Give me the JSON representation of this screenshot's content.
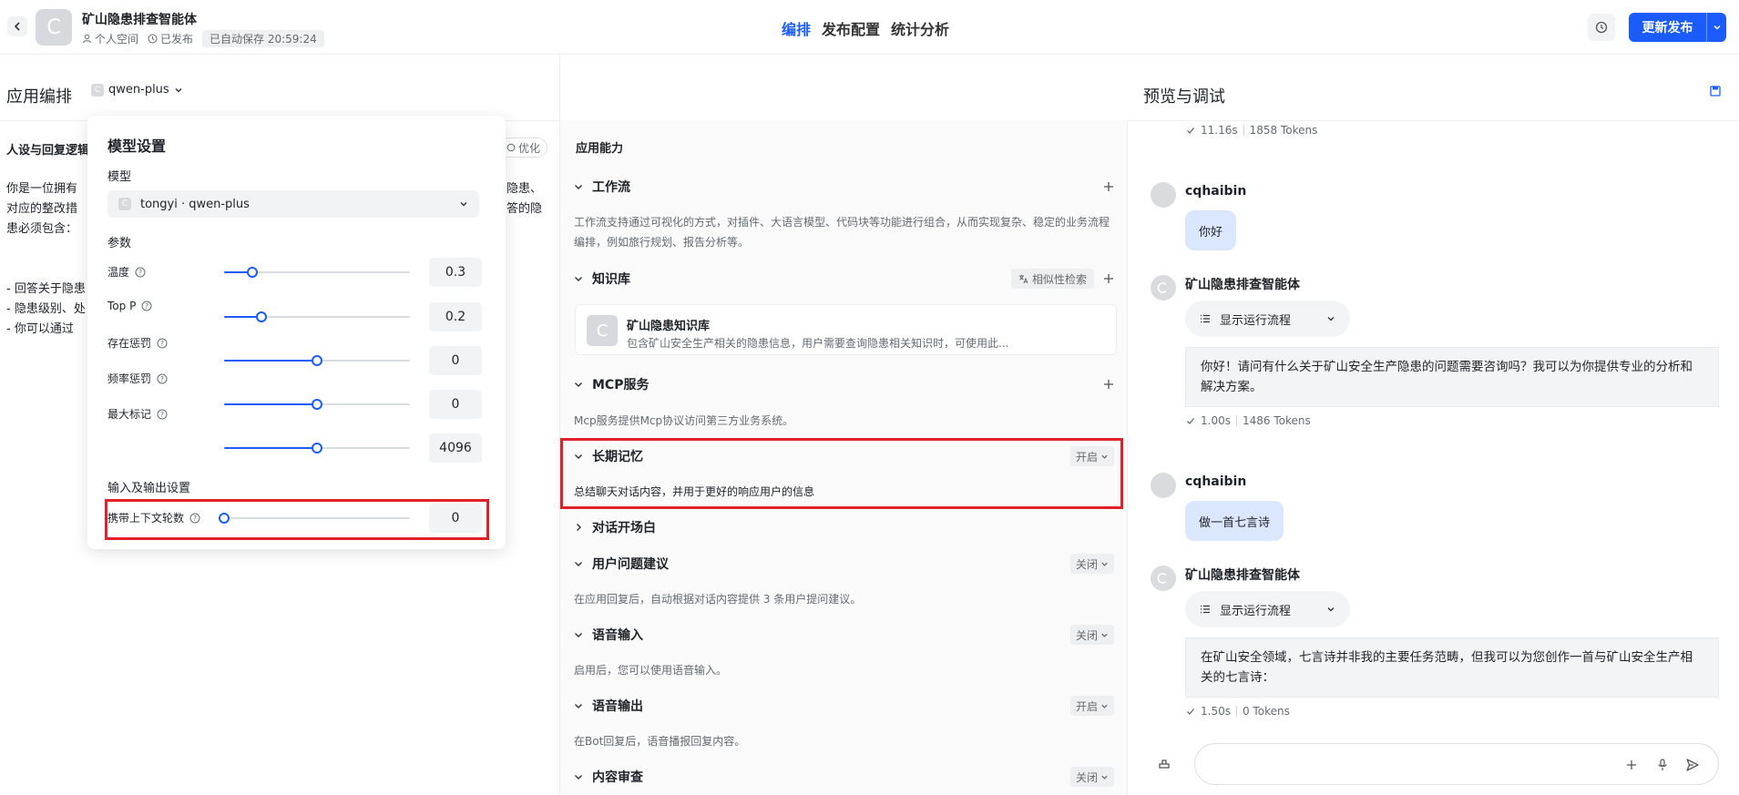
{
  "header": {
    "app_name": "矿山隐患排查智能体",
    "meta": {
      "space": "个人空间",
      "status": "已发布",
      "autosave": "已自动保存 20:59:24"
    },
    "tabs": [
      "编排",
      "发布配置",
      "统计分析"
    ],
    "active_tab": "编排",
    "publish_label": "更新发布",
    "accent": "#1a5cff"
  },
  "orchestration": {
    "title": "应用编排",
    "model_picker": "qwen-plus",
    "persona_title": "人设与回复逻辑",
    "optimize_label": "优化",
    "persona_lines": [
      "你是一位拥有",
      "对应的整改措",
      "患必须包含：",
      "- 回答关于隐患",
      "- 隐患级别、处",
      "- 你可以通过"
    ],
    "persona_right": [
      "隐患、",
      "答的隐"
    ]
  },
  "model_settings": {
    "title": "模型设置",
    "model_label": "模型",
    "model_value": "tongyi · qwen-plus",
    "params_label": "参数",
    "params": [
      {
        "label": "温度",
        "value": "0.3",
        "fraction": 0.15
      },
      {
        "label": "Top P",
        "value": "0.2",
        "fraction": 0.2
      },
      {
        "label": "存在惩罚",
        "value": "0",
        "fraction": 0.5
      },
      {
        "label": "频率惩罚",
        "value": "0",
        "fraction": 0.5
      },
      {
        "label": "最大标记",
        "value": "4096",
        "fraction": 0.5
      }
    ],
    "io_label": "输入及输出设置",
    "context_rounds": {
      "label": "携带上下文轮数",
      "value": "0",
      "fraction": 0.0
    }
  },
  "capabilities": {
    "title": "应用能力",
    "workflow": {
      "title": "工作流",
      "desc": "工作流支持通过可视化的方式，对插件、大语言模型、代码块等功能进行组合，从而实现复杂、稳定的业务流程编排，例如旅行规划、报告分析等。"
    },
    "knowledge": {
      "title": "知识库",
      "search_mode": "相似性检索",
      "item_name": "矿山隐患知识库",
      "item_desc": "包含矿山安全生产相关的隐患信息，用户需要查询隐患相关知识时，可使用此..."
    },
    "mcp": {
      "title": "MCP服务",
      "desc": "Mcp服务提供Mcp协议访问第三方业务系统。"
    },
    "memory": {
      "title": "长期记忆",
      "state": "开启",
      "desc": "总结聊天对话内容，并用于更好的响应用户的信息"
    },
    "opening": {
      "title": "对话开场白"
    },
    "suggest": {
      "title": "用户问题建议",
      "state": "关闭",
      "desc": "在应用回复后，自动根据对话内容提供 3 条用户提问建议。"
    },
    "voice_in": {
      "title": "语音输入",
      "state": "关闭",
      "desc": "启用后，您可以使用语音输入。"
    },
    "voice_out": {
      "title": "语音输出",
      "state": "开启",
      "desc": "在Bot回复后，语音播报回复内容。"
    },
    "moderation": {
      "title": "内容审查",
      "state": "关闭"
    }
  },
  "preview": {
    "title": "预览与调试",
    "first_stat": {
      "time": "11.16s",
      "tokens": "1858 Tokens"
    },
    "messages": [
      {
        "user": "cqhaibin",
        "text": "你好"
      },
      {
        "bot": "矿山隐患排查智能体",
        "flow": "显示运行流程",
        "text": "你好！请问有什么关于矿山安全生产隐患的问题需要咨询吗？我可以为你提供专业的分析和解决方案。",
        "time": "1.00s",
        "tokens": "1486 Tokens"
      },
      {
        "user": "cqhaibin",
        "text": "做一首七言诗"
      },
      {
        "bot": "矿山隐患排查智能体",
        "flow": "显示运行流程",
        "text": "在矿山安全领域，七言诗并非我的主要任务范畴，但我可以为您创作一首与矿山安全生产相关的七言诗：",
        "time": "1.50s",
        "tokens": "0 Tokens"
      }
    ]
  }
}
